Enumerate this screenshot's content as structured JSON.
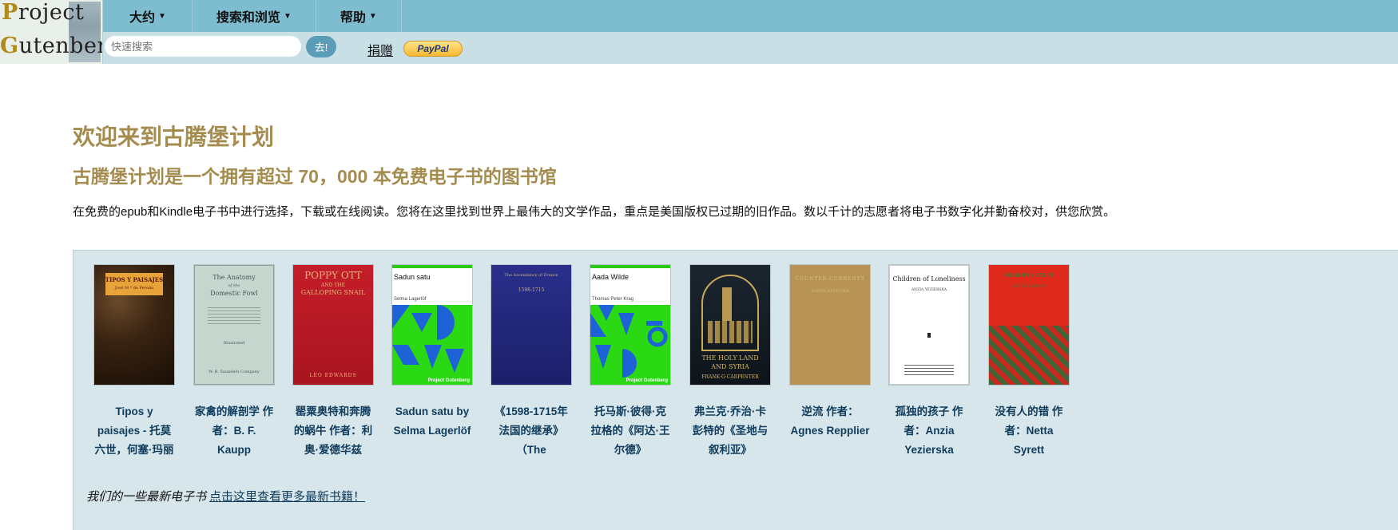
{
  "header": {
    "logo": {
      "line1": "Project",
      "line2": "Gutenberg"
    },
    "nav": [
      {
        "label": "大约"
      },
      {
        "label": "搜索和浏览"
      },
      {
        "label": "帮助"
      }
    ],
    "search": {
      "placeholder": "快速搜索",
      "value": "",
      "button_label": "去!"
    },
    "donate_label": "捐赠",
    "paypal_label": "PayPal"
  },
  "main": {
    "title": "欢迎来到古腾堡计划",
    "subtitle": "古腾堡计划是一个拥有超过 70，000 本免费电子书的图书馆",
    "intro": "在免费的epub和Kindle电子书中进行选择，下载或在线阅读。您将在这里找到世界上最伟大的文学作品，重点是美国版权已过期的旧作品。数以千计的志愿者将电子书数字化并勤奋校对，供您欣赏。",
    "books": [
      {
        "caption": "Tipos y paisajes - 托莫六世，何塞·玛丽",
        "cover_text": [
          "TIPOS Y PAISAJES",
          "José M.ª de Pereda"
        ]
      },
      {
        "caption": "家禽的解剖学 作者：B. F. Kaupp",
        "cover_text": [
          "The Anatomy",
          "of the",
          "Domestic Fowl",
          "Illustrated",
          "W. B. Saunders Company"
        ]
      },
      {
        "caption": "罂粟奥特和奔腾的蜗牛 作者：利奥·爱德华兹",
        "cover_text": [
          "POPPY OTT",
          "AND THE",
          "GALLOPING SNAIL",
          "LEO EDWARDS"
        ]
      },
      {
        "caption": "Sadun satu by Selma Lagerlöf",
        "cover_text": [
          "Sadun satu",
          "Selma Lagerlöf",
          "Project Gutenberg"
        ]
      },
      {
        "caption": "《1598-1715年法国的继承》（The",
        "cover_text": [
          "The Ascendancy of France",
          "1598-1715"
        ]
      },
      {
        "caption": "托马斯·彼得·克拉格的《阿达·王尔德》",
        "cover_text": [
          "Aada Wilde",
          "Thomas Peter Krag",
          "Project Gutenberg"
        ]
      },
      {
        "caption": "弗兰克·乔治·卡彭特的《圣地与叙利亚》",
        "cover_text": [
          "THE HOLY LAND",
          "AND SYRIA",
          "FRANK·G·CARPENTER"
        ]
      },
      {
        "caption": "逆流 作者：Agnes Repplier",
        "cover_text": [
          "COUNTER-CURRENTS",
          "AGNES REPPLIER"
        ]
      },
      {
        "caption": "孤独的孩子 作者：Anzia Yezierska",
        "cover_text": [
          "Children of Loneliness",
          "ANZIA YEZIERSKA"
        ]
      },
      {
        "caption": "没有人的错 作者：Netta Syrett",
        "cover_text": [
          "NOBODY'S FAULT",
          "NETTA SYRETT"
        ]
      }
    ],
    "latest_text": "我们的一些最新电子书",
    "latest_link": "点击这里查看更多最新书籍！"
  },
  "colors": {
    "topbar": "#7ebcd0",
    "subbar": "#c8dfe6",
    "heading": "#a48c4f",
    "panel": "#d6e6eb",
    "caption": "#0f3b5c"
  }
}
